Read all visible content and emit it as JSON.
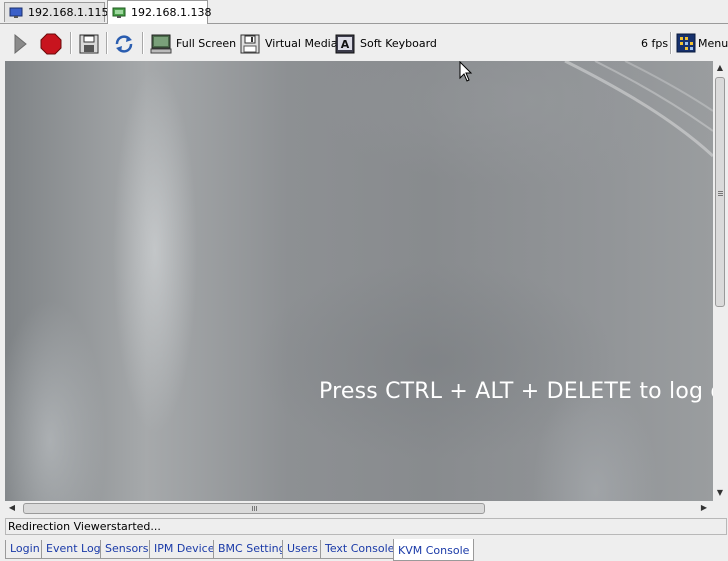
{
  "host_tabs": [
    {
      "label": "192.168.1.115",
      "icon": "monitor-icon",
      "active": false
    },
    {
      "label": "192.168.1.138",
      "icon": "network-monitor-icon",
      "active": true
    }
  ],
  "toolbar": {
    "play_icon": "play-icon",
    "stop_icon": "stop-icon",
    "save_icon": "floppy-save-icon",
    "refresh_icon": "refresh-icon",
    "full_screen_label": "Full Screen",
    "virtual_media_label": "Virtual Media",
    "soft_keyboard_label": "Soft Keyboard",
    "fps": "6 fps",
    "menu_label": "Menu"
  },
  "screen": {
    "message": "Press CTRL + ALT + DELETE to log on"
  },
  "status": "Redirection Viewerstarted...",
  "bottom_tabs": [
    {
      "label": "Login",
      "active": false
    },
    {
      "label": "Event Log",
      "active": false
    },
    {
      "label": "Sensors",
      "active": false
    },
    {
      "label": "IPM Device",
      "active": false
    },
    {
      "label": "BMC Setting",
      "active": false
    },
    {
      "label": "Users",
      "active": false
    },
    {
      "label": "Text Console",
      "active": false
    },
    {
      "label": "KVM Console",
      "active": true
    }
  ],
  "colors": {
    "tab_text": "#1a3aa8",
    "stop_red": "#c8141e",
    "screen_base": "#8d9093"
  }
}
